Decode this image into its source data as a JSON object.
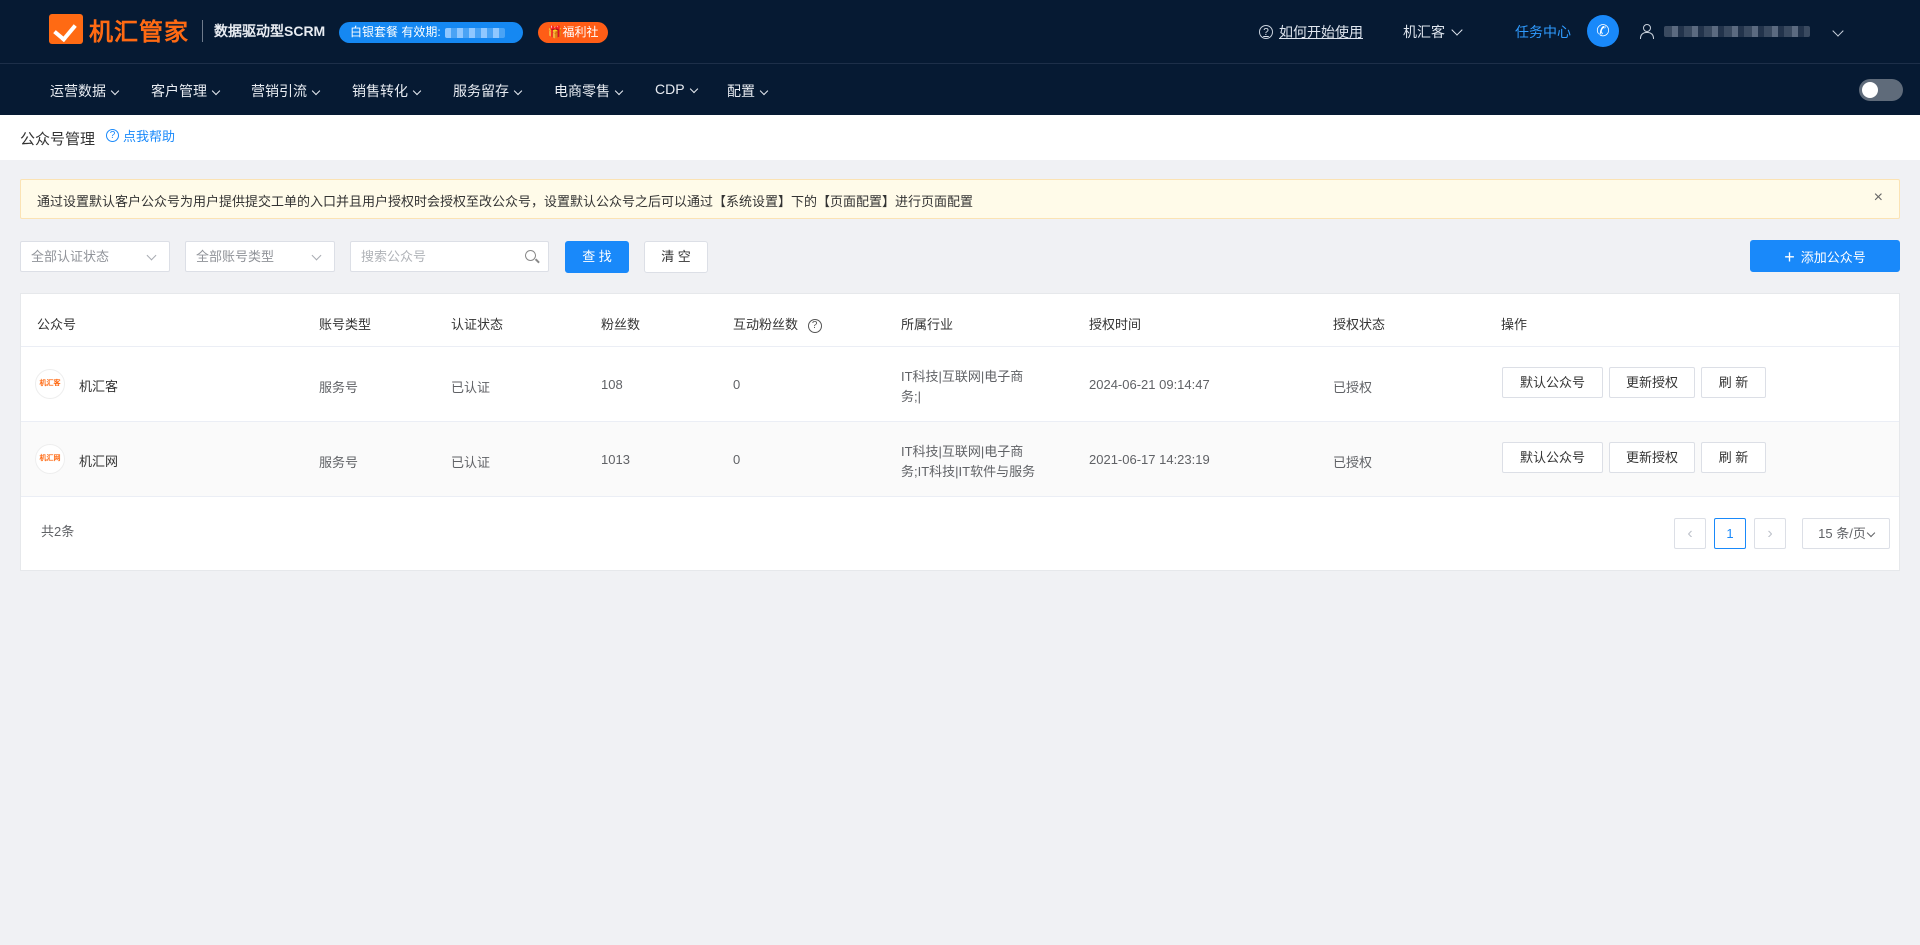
{
  "header": {
    "brand": "机汇管家",
    "slogan": "数据驱动型SCRM",
    "package_label": "白银套餐 有效期:",
    "welfare_label": "福利社",
    "help_label": "如何开始使用",
    "org_label": "机汇客",
    "task_center_label": "任务中心"
  },
  "nav": {
    "items": [
      "运营数据",
      "客户管理",
      "营销引流",
      "销售转化",
      "服务留存",
      "电商零售",
      "CDP",
      "配置"
    ]
  },
  "page": {
    "title": "公众号管理",
    "help_label": "点我帮助"
  },
  "notice": {
    "text": "通过设置默认客户公众号为用户提供提交工单的入口并且用户授权时会授权至改公众号，设置默认公众号之后可以通过【系统设置】下的【页面配置】进行页面配置"
  },
  "filters": {
    "auth_status_placeholder": "全部认证状态",
    "account_type_placeholder": "全部账号类型",
    "search_placeholder": "搜索公众号",
    "search_value": "",
    "find_label": "查 找",
    "clear_label": "清 空",
    "add_label": "添加公众号"
  },
  "table": {
    "columns": [
      "公众号",
      "账号类型",
      "认证状态",
      "粉丝数",
      "互动粉丝数",
      "所属行业",
      "授权时间",
      "授权状态",
      "操作"
    ],
    "rows": [
      {
        "logo_text": "机汇客",
        "name": "机汇客",
        "account_type": "服务号",
        "verify_status": "已认证",
        "fans": "108",
        "active_fans": "0",
        "industry_line1": "IT科技|互联网|电子商",
        "industry_line2": "务;|",
        "auth_time": "2024-06-21 09:14:47",
        "auth_status": "已授权"
      },
      {
        "logo_text": "机汇网",
        "name": "机汇网",
        "account_type": "服务号",
        "verify_status": "已认证",
        "fans": "1013",
        "active_fans": "0",
        "industry_line1": "IT科技|互联网|电子商",
        "industry_line2": "务;IT科技|IT软件与服务",
        "auth_time": "2021-06-17 14:23:19",
        "auth_status": "已授权"
      }
    ],
    "actions": {
      "default_label": "默认公众号",
      "reauth_label": "更新授权",
      "refresh_label": "刷 新"
    }
  },
  "footer": {
    "total_label": "共2条",
    "current_page": "1",
    "page_size": "15 条/页"
  },
  "colors": {
    "topbar": "#061a33",
    "brand_orange": "#ff6a13",
    "primary": "#1989fa"
  }
}
